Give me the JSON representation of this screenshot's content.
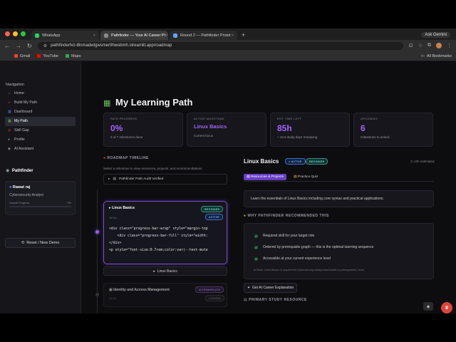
{
  "browser": {
    "tabs": [
      {
        "label": "WhatsApp",
        "favicon_color": "#25d366"
      },
      {
        "label": "Pathfinder — Your AI Career Pl",
        "favicon_color": "#8a8a8a",
        "active": true
      },
      {
        "label": "Round 2 — Pathfinder Protot",
        "favicon_color": "#6aa0ff"
      }
    ],
    "ask_gemini": "Ask Gemini",
    "url": "pathfinderhcl-l8nmadwtgwsmer9hwsbmh.streamlit.app/roadmap",
    "bookmarks": [
      {
        "label": "Gmail",
        "color": "#ea4335"
      },
      {
        "label": "YouTube",
        "color": "#ff0000"
      },
      {
        "label": "Maps",
        "color": "#34a853"
      }
    ],
    "all_bookmarks": "All Bookmarks"
  },
  "sidebar": {
    "heading": "Navigation",
    "items": [
      {
        "label": "Home",
        "icon": "home-icon"
      },
      {
        "label": "Build My Path",
        "icon": "rocket-icon"
      },
      {
        "label": "Dashboard",
        "icon": "chart-icon"
      },
      {
        "label": "My Path",
        "icon": "map-icon",
        "active": true
      },
      {
        "label": "Skill Gap",
        "icon": "target-icon"
      },
      {
        "label": "Profile",
        "icon": "person-icon"
      },
      {
        "label": "AI Assistant",
        "icon": "robot-icon"
      }
    ],
    "brand": "Pathfinder",
    "profile": {
      "name": "Rawat raj",
      "role": "Cybersecurity Analyst",
      "progress_label": "Overall Progress",
      "progress_value": "0%"
    },
    "reset_label": "Reset / New Demo"
  },
  "main": {
    "title": "My Learning Path",
    "stats": [
      {
        "label": "PATH PROGRESS",
        "value": "0%",
        "sub": "0 of 7 milestones done"
      },
      {
        "label": "ACTIVE MILESTONE",
        "value": "Linux Basics",
        "sub": "Current focus"
      },
      {
        "label": "EST. TIME LEFT",
        "value": "85h",
        "sub": "~ 10.6 study days remaining"
      },
      {
        "label": "UPCOMING",
        "value": "6",
        "sub": "milestones to unlock"
      }
    ],
    "timeline": {
      "title": "ROADMAP TIMELINE",
      "note": "Select a milestone to view resources, projects, and recommendations.",
      "audit_label": "Pathfinder Path Audit Verified",
      "active_card": {
        "title": "Linux Basics",
        "meta": "10 h/h",
        "badge_level": "BEGINNER",
        "badge_status": "ACTIVE",
        "code_lines": [
          "<div class=\"progress-bar-wrap\" style=\"margin-top",
          "    <div class=\"progress-bar-fill\" style=\"width:",
          "</div>",
          "<p style=\"font-size:0.7rem;color:var(--text-mute"
        ]
      },
      "linux_button": "Linux Basics",
      "next_card": {
        "title": "Identity and Access Management",
        "meta": "12 h/h",
        "badge_level": "INTERMEDIATE",
        "badge_status": "LOCKED"
      }
    },
    "detail": {
      "title": "Linux Basics",
      "badge_status": "ACTIVE",
      "badge_level": "BEGINNER",
      "estimate": "10h estimated",
      "tabs": [
        "Resources & Projects",
        "Practice Quiz"
      ],
      "description": "Learn the essentials of Linux Basics including core syntax and practical applications.",
      "why_title": "WHY PATHFINDER RECOMMENDED THIS",
      "why_items": [
        "Required skill for your target role",
        "Ordered by prerequisite graph — this is the optimal learning sequence",
        "Accessible at your current experience level"
      ],
      "why_note": "AI Note: Linux Basics is required for Cybersecurity Analyst and builds on prerequisites: none",
      "gemini_button": "Get AI Career Explanation",
      "primary_title": "PRIMARY STUDY RESOURCE"
    }
  },
  "colors": {
    "accent": "#a464f5",
    "active_border": "#7b4fd0",
    "beginner": "#6cd3c8",
    "active": "#7fb2ff"
  }
}
